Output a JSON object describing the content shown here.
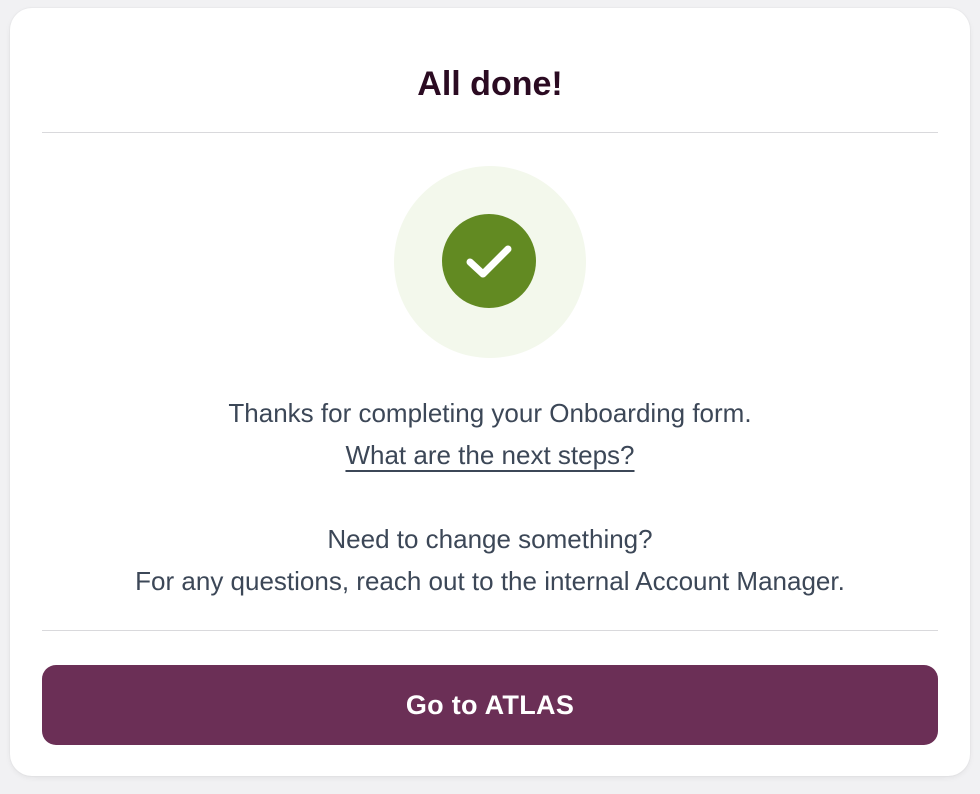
{
  "header": {
    "title": "All done!"
  },
  "status": {
    "icon": "check-circle-icon",
    "halo_color": "#f3f8ec",
    "check_color": "#628a22"
  },
  "message": {
    "thanks": "Thanks for completing your Onboarding form.",
    "next_steps_link": "What are the next steps?",
    "change_prompt": "Need to change something?",
    "contact": "For any questions, reach out to the internal Account Manager."
  },
  "actions": {
    "primary_label": "Go to ATLAS",
    "primary_color": "#6b2f56"
  }
}
